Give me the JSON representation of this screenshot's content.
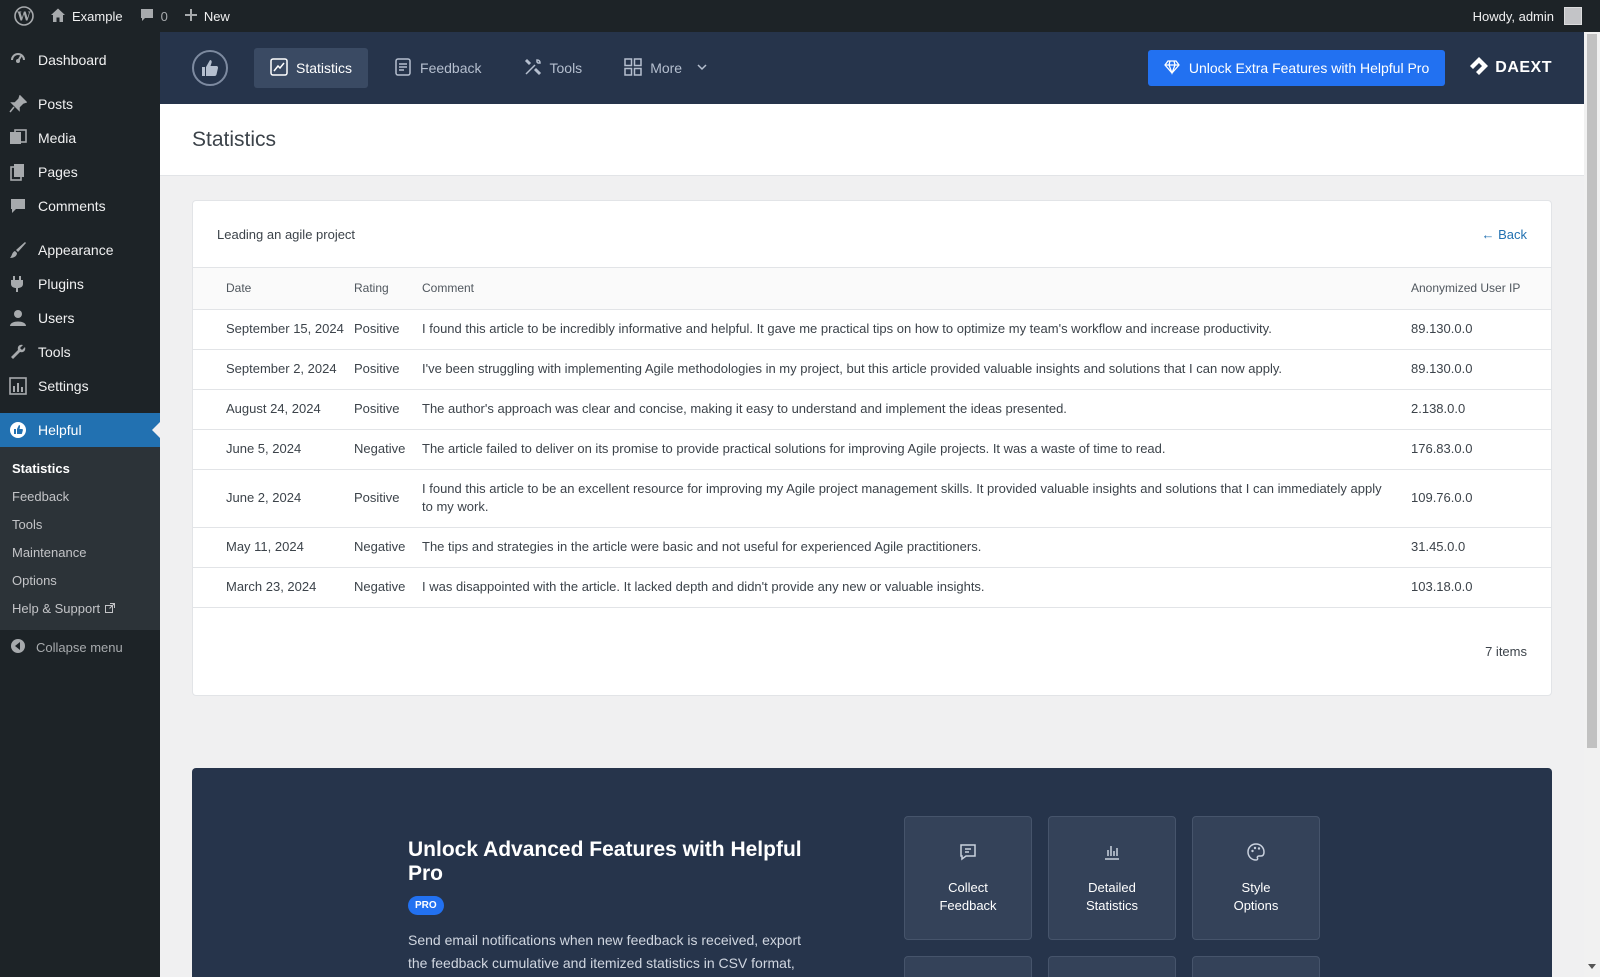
{
  "adminbar": {
    "site_name": "Example",
    "comments_count": "0",
    "new_label": "New",
    "howdy": "Howdy, admin"
  },
  "sidebar": {
    "items": [
      {
        "label": "Dashboard",
        "icon": "dashboard-icon"
      },
      {
        "label": "Posts",
        "icon": "pin-icon"
      },
      {
        "label": "Media",
        "icon": "media-icon"
      },
      {
        "label": "Pages",
        "icon": "pages-icon"
      },
      {
        "label": "Comments",
        "icon": "comment-icon"
      },
      {
        "label": "Appearance",
        "icon": "brush-icon"
      },
      {
        "label": "Plugins",
        "icon": "plug-icon"
      },
      {
        "label": "Users",
        "icon": "user-icon"
      },
      {
        "label": "Tools",
        "icon": "wrench-icon"
      },
      {
        "label": "Settings",
        "icon": "settings-icon"
      },
      {
        "label": "Helpful",
        "icon": "thumbs-up-icon"
      }
    ],
    "submenu": [
      "Statistics",
      "Feedback",
      "Tools",
      "Maintenance",
      "Options",
      "Help & Support"
    ],
    "collapse_label": "Collapse menu"
  },
  "plugin_nav": {
    "tabs": [
      "Statistics",
      "Feedback",
      "Tools",
      "More"
    ],
    "pro_button": "Unlock Extra Features with Helpful Pro",
    "brand": "DAEXT"
  },
  "page": {
    "title": "Statistics"
  },
  "card": {
    "post_title": "Leading an agile project",
    "back_label": "← Back",
    "columns": [
      "Date",
      "Rating",
      "Comment",
      "Anonymized User IP"
    ],
    "rows": [
      {
        "date": "September 15, 2024",
        "rating": "Positive",
        "comment": "I found this article to be incredibly informative and helpful. It gave me practical tips on how to optimize my team's workflow and increase productivity.",
        "ip": "89.130.0.0"
      },
      {
        "date": "September 2, 2024",
        "rating": "Positive",
        "comment": "I've been struggling with implementing Agile methodologies in my project, but this article provided valuable insights and solutions that I can now apply.",
        "ip": "89.130.0.0"
      },
      {
        "date": "August 24, 2024",
        "rating": "Positive",
        "comment": "The author's approach was clear and concise, making it easy to understand and implement the ideas presented.",
        "ip": "2.138.0.0"
      },
      {
        "date": "June 5, 2024",
        "rating": "Negative",
        "comment": "The article failed to deliver on its promise to provide practical solutions for improving Agile projects. It was a waste of time to read.",
        "ip": "176.83.0.0"
      },
      {
        "date": "June 2, 2024",
        "rating": "Positive",
        "comment": "I found this article to be an excellent resource for improving my Agile project management skills. It provided valuable insights and solutions that I can immediately apply to my work.",
        "ip": "109.76.0.0"
      },
      {
        "date": "May 11, 2024",
        "rating": "Negative",
        "comment": "The tips and strategies in the article were basic and not useful for experienced Agile practitioners.",
        "ip": "31.45.0.0"
      },
      {
        "date": "March 23, 2024",
        "rating": "Negative",
        "comment": "I was disappointed with the article. It lacked depth and didn't provide any new or valuable insights.",
        "ip": "103.18.0.0"
      }
    ],
    "items_count": "7 items"
  },
  "upsell": {
    "heading": "Unlock Advanced Features with Helpful Pro",
    "badge": "PRO",
    "text": "Send email notifications when new feedback is received, export the feedback cumulative and itemized statistics in CSV format, download the single feedback in PDF format, configure the",
    "features": [
      "Collect Feedback",
      "Detailed Statistics",
      "Style Options"
    ]
  },
  "colors": {
    "admin_dark": "#1d2327",
    "plugin_navy": "#26344b",
    "accent_blue": "#2271f1",
    "wp_blue": "#2271b1"
  }
}
